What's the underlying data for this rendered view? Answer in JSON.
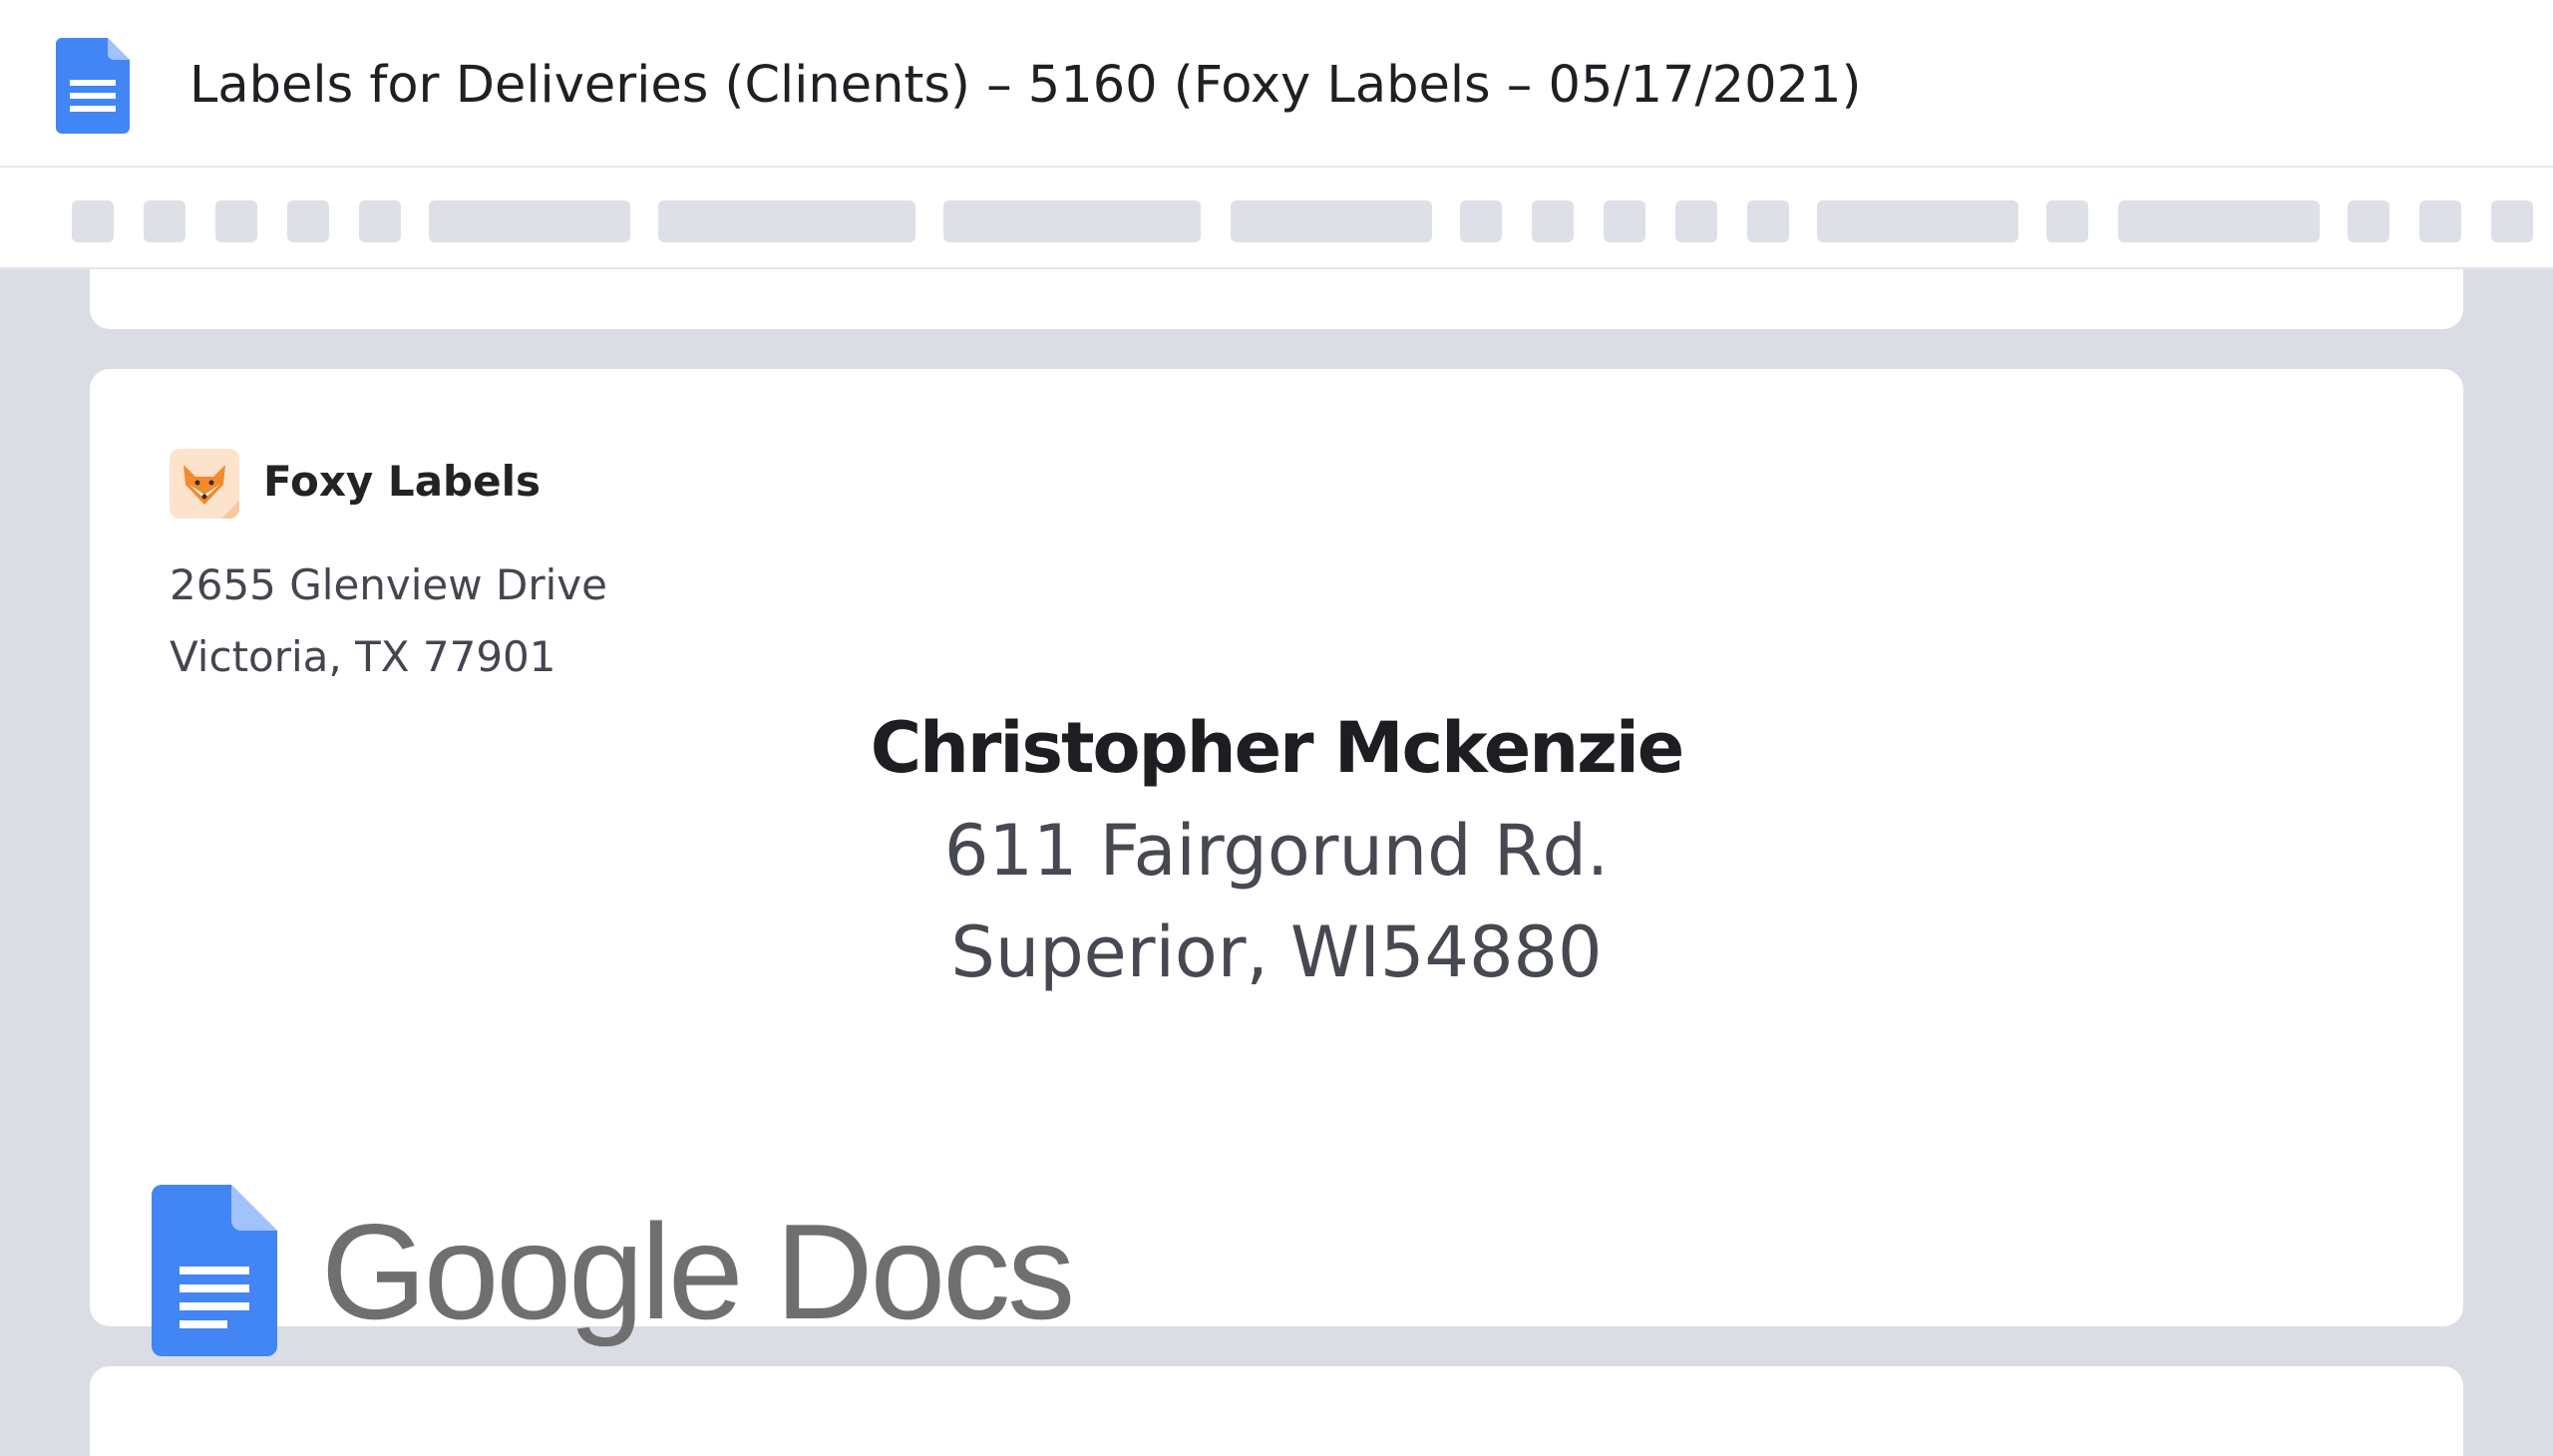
{
  "window": {
    "title": "Labels for Deliveries (Clinents) – 5160 (Foxy Labels – 05/17/2021)",
    "app_icon": "google-docs-icon"
  },
  "toolbar": {
    "buttons": [
      "toolbar-button",
      "toolbar-button",
      "toolbar-button",
      "toolbar-button",
      "toolbar-button",
      "toolbar-dropdown",
      "toolbar-dropdown",
      "toolbar-dropdown",
      "toolbar-dropdown",
      "toolbar-button",
      "toolbar-button",
      "toolbar-button",
      "toolbar-button",
      "toolbar-button",
      "toolbar-dropdown",
      "toolbar-button",
      "toolbar-dropdown",
      "toolbar-button",
      "toolbar-button",
      "toolbar-button"
    ]
  },
  "label": {
    "sender": {
      "brand_name": "Foxy Labels",
      "brand_icon": "fox-icon",
      "address_line1": "2655 Glenview Drive",
      "address_line2": "Victoria, TX 77901"
    },
    "recipient": {
      "name": "Christopher Mckenzie",
      "address_line1": "611 Fairgorund Rd.",
      "address_line2": "Superior, WI54880"
    }
  },
  "watermark": {
    "text": "Google Docs",
    "icon": "google-docs-icon"
  },
  "colors": {
    "docs_blue": "#4285f4",
    "docs_fold": "#a1c2fa",
    "canvas_gray": "#dadde3",
    "fox_orange": "#f28a2e"
  }
}
